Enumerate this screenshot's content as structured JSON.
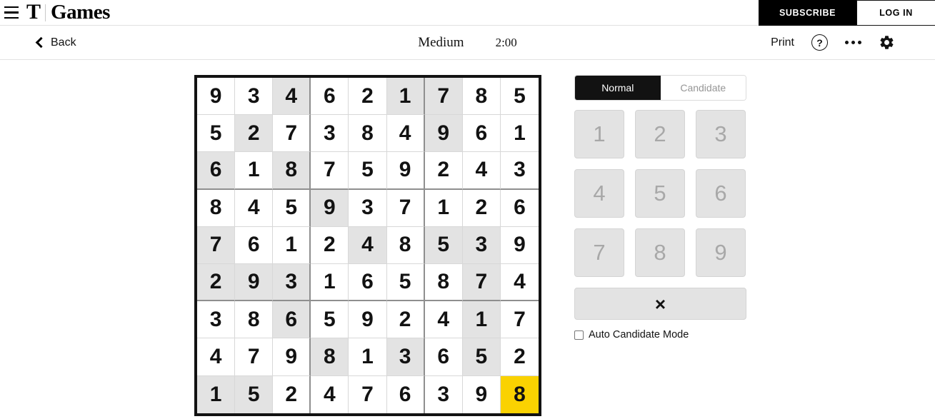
{
  "masthead": {
    "menu_icon": "hamburger-icon",
    "logo_t": "T",
    "logo_word": "Games",
    "subscribe_label": "SUBSCRIBE",
    "login_label": "LOG IN"
  },
  "toolbar": {
    "back_label": "Back",
    "back_icon": "chevron-left-icon",
    "difficulty": "Medium",
    "timer": "2:00",
    "print_label": "Print",
    "help_icon": "question-mark-icon",
    "help_glyph": "?",
    "more_icon": "ellipsis-icon",
    "settings_icon": "gear-icon"
  },
  "panel": {
    "modes": [
      {
        "label": "Normal",
        "active": true
      },
      {
        "label": "Candidate",
        "active": false
      }
    ],
    "numbers": [
      "1",
      "2",
      "3",
      "4",
      "5",
      "6",
      "7",
      "8",
      "9"
    ],
    "erase_label": "×",
    "erase_icon": "erase-x-icon",
    "auto_candidate_label": "Auto Candidate Mode",
    "auto_candidate_checked": false
  },
  "colors": {
    "selected_cell": "#fad201",
    "shaded_cell": "#e3e3e3",
    "grid_line": "#d8d8d8",
    "box_line": "#8f8f8f",
    "outer_border": "#121212",
    "accent_black": "#000000"
  },
  "board": {
    "rows": [
      [
        "9",
        "3",
        "4",
        "6",
        "2",
        "1",
        "7",
        "8",
        "5"
      ],
      [
        "5",
        "2",
        "7",
        "3",
        "8",
        "4",
        "9",
        "6",
        "1"
      ],
      [
        "6",
        "1",
        "8",
        "7",
        "5",
        "9",
        "2",
        "4",
        "3"
      ],
      [
        "8",
        "4",
        "5",
        "9",
        "3",
        "7",
        "1",
        "2",
        "6"
      ],
      [
        "7",
        "6",
        "1",
        "2",
        "4",
        "8",
        "5",
        "3",
        "9"
      ],
      [
        "2",
        "9",
        "3",
        "1",
        "6",
        "5",
        "8",
        "7",
        "4"
      ],
      [
        "3",
        "8",
        "6",
        "5",
        "9",
        "2",
        "4",
        "1",
        "7"
      ],
      [
        "4",
        "7",
        "9",
        "8",
        "1",
        "3",
        "6",
        "5",
        "2"
      ],
      [
        "1",
        "5",
        "2",
        "4",
        "7",
        "6",
        "3",
        "9",
        "8"
      ]
    ],
    "shaded": [
      [
        0,
        0,
        1,
        0,
        0,
        1,
        1,
        0,
        0
      ],
      [
        0,
        1,
        0,
        0,
        0,
        0,
        1,
        0,
        0
      ],
      [
        1,
        0,
        1,
        0,
        0,
        0,
        0,
        0,
        0
      ],
      [
        0,
        0,
        0,
        1,
        0,
        0,
        0,
        0,
        0
      ],
      [
        1,
        0,
        0,
        0,
        1,
        0,
        1,
        1,
        0
      ],
      [
        1,
        1,
        1,
        0,
        0,
        0,
        0,
        1,
        0
      ],
      [
        0,
        0,
        1,
        0,
        0,
        0,
        0,
        1,
        0
      ],
      [
        0,
        0,
        0,
        1,
        0,
        1,
        0,
        1,
        0
      ],
      [
        1,
        1,
        0,
        0,
        0,
        0,
        0,
        0,
        0
      ]
    ],
    "selected": {
      "row": 8,
      "col": 8
    }
  }
}
